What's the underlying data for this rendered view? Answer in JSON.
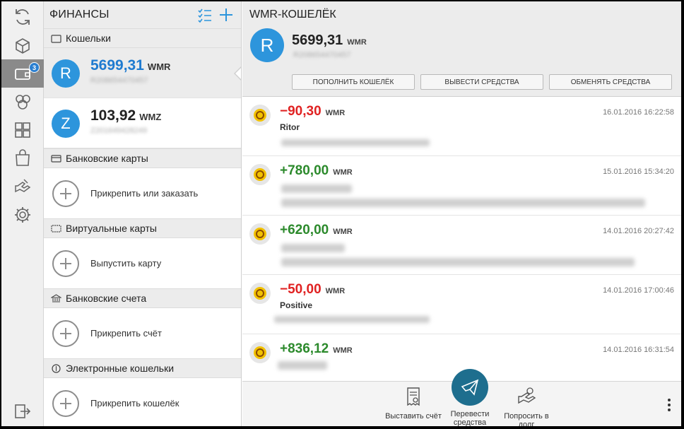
{
  "rail": {
    "icons": [
      "refresh-icon",
      "boxes-icon",
      "wallet-icon",
      "contacts-icon",
      "apps-icon",
      "shop-bag-icon",
      "handshake-icon",
      "settings-icon"
    ],
    "badge": "3",
    "logout_icon": "logout-icon"
  },
  "finances": {
    "title": "ФИНАНСЫ",
    "sections": {
      "wallets": "Кошельки",
      "bank_cards": "Банковские карты",
      "virtual_cards": "Виртуальные карты",
      "bank_accounts": "Банковские счета",
      "e_wallets": "Электронные кошельки"
    },
    "wallets": [
      {
        "letter": "R",
        "amount": "5699,31",
        "currency": "WMR",
        "number": "R208654470457"
      },
      {
        "letter": "Z",
        "amount": "103,92",
        "currency": "WMZ",
        "number": "Z201649428249"
      }
    ],
    "attach": {
      "bank_cards": "Прикрепить или заказать",
      "virtual_cards": "Выпустить карту",
      "bank_accounts": "Прикрепить счёт",
      "e_wallets": "Прикрепить кошелёк"
    }
  },
  "wallet_view": {
    "title": "WMR-КОШЕЛЁК",
    "letter": "R",
    "amount": "5699,31",
    "currency": "WMR",
    "number": "R208654470457",
    "actions": {
      "topup": "ПОПОЛНИТЬ КОШЕЛЁК",
      "withdraw": "ВЫВЕСТИ СРЕДСТВА",
      "exchange": "ОБМЕНЯТЬ СРЕДСТВА"
    }
  },
  "transactions": [
    {
      "amount": "−90,30",
      "currency": "WMR",
      "sign": "neg",
      "date": "16.01.2016 16:22:58",
      "name": "Ritor"
    },
    {
      "amount": "+780,00",
      "currency": "WMR",
      "sign": "pos",
      "date": "15.01.2016 15:34:20",
      "name": ""
    },
    {
      "amount": "+620,00",
      "currency": "WMR",
      "sign": "pos",
      "date": "14.01.2016 20:27:42",
      "name": ""
    },
    {
      "amount": "−50,00",
      "currency": "WMR",
      "sign": "neg",
      "date": "14.01.2016 17:00:46",
      "name": "Positive"
    },
    {
      "amount": "+836,12",
      "currency": "WMR",
      "sign": "pos",
      "date": "14.01.2016 16:31:54",
      "name": ""
    }
  ],
  "bottom": {
    "invoice": "Выставить счёт",
    "transfer": "Перевести средства",
    "borrow": "Попросить в долг"
  },
  "colors": {
    "accent": "#2d95dc",
    "positive": "#2c8a2c",
    "negative": "#e02222",
    "primary_button": "#1e6e8e"
  }
}
